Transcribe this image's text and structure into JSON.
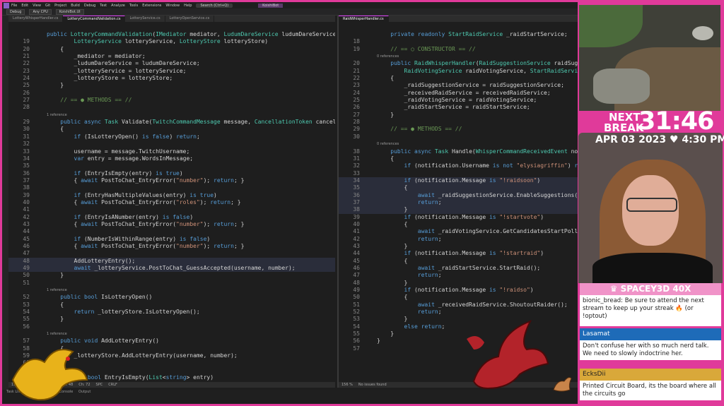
{
  "menubar": {
    "items": [
      "File",
      "Edit",
      "View",
      "Git",
      "Project",
      "Build",
      "Debug",
      "Test",
      "Analyze",
      "Tools",
      "Extensions",
      "Window",
      "Help"
    ],
    "search": "Search (Ctrl+Q)",
    "app_name": "KoishiBot"
  },
  "toolbar": {
    "config": "Debug",
    "platform": "Any CPU",
    "run_target": "KoishiBot.UI"
  },
  "left_editor": {
    "tabs": [
      "LotteryWhisperHandler.cs",
      "LotteryCommandValidation.cs",
      "LotteryService.cs",
      "LotteryOpenService.cs"
    ],
    "lines": [
      {
        "num": "",
        "text": "public LotteryCommandValidation(IMediator mediator, LudumDareService ludumDareService,",
        "hl": false
      },
      {
        "num": "19",
        "text": "        LotteryService lotteryService, LotteryStore lotteryStore)",
        "hl": false
      },
      {
        "num": "20",
        "text": "    {",
        "hl": false
      },
      {
        "num": "21",
        "text": "        _mediator = mediator;",
        "hl": false
      },
      {
        "num": "22",
        "text": "        _ludumDareService = ludumDareService;",
        "hl": false
      },
      {
        "num": "23",
        "text": "        _lotteryService = lotteryService;",
        "hl": false
      },
      {
        "num": "24",
        "text": "        _lotteryStore = lotteryStore;",
        "hl": false
      },
      {
        "num": "25",
        "text": "    }",
        "hl": false
      },
      {
        "num": "26",
        "text": "",
        "hl": false
      },
      {
        "num": "27",
        "text": "    // == ● METHODS == //",
        "hl": false
      },
      {
        "num": "28",
        "text": "",
        "hl": false
      },
      {
        "num": "ref",
        "text": "1 reference",
        "hl": false
      },
      {
        "num": "29",
        "text": "    public async Task Validate(TwitchCommandMessage message, CancellationToken cancelToken)",
        "hl": false
      },
      {
        "num": "30",
        "text": "    {",
        "hl": false
      },
      {
        "num": "31",
        "text": "        if (IsLotteryOpen() is false) return;",
        "hl": false
      },
      {
        "num": "32",
        "text": "",
        "hl": false
      },
      {
        "num": "33",
        "text": "        username = message.TwitchUsername;",
        "hl": false
      },
      {
        "num": "34",
        "text": "        var entry = message.WordsInMessage;",
        "hl": false
      },
      {
        "num": "35",
        "text": "",
        "hl": false
      },
      {
        "num": "36",
        "text": "        if (EntryIsEmpty(entry) is true)",
        "hl": false
      },
      {
        "num": "37",
        "text": "        { await PostToChat_EntryError(\"number\"); return; }",
        "hl": false
      },
      {
        "num": "38",
        "text": "",
        "hl": false
      },
      {
        "num": "39",
        "text": "        if (EntryHasMultipleValues(entry) is true)",
        "hl": false
      },
      {
        "num": "40",
        "text": "        { await PostToChat_EntryError(\"roles\"); return; }",
        "hl": false
      },
      {
        "num": "41",
        "text": "",
        "hl": false
      },
      {
        "num": "42",
        "text": "        if (EntryIsANumber(entry) is false)",
        "hl": false
      },
      {
        "num": "43",
        "text": "        { await PostToChat_EntryError(\"number\"); return; }",
        "hl": false
      },
      {
        "num": "44",
        "text": "",
        "hl": false
      },
      {
        "num": "45",
        "text": "        if (NumberIsWithinRange(entry) is false)",
        "hl": false
      },
      {
        "num": "46",
        "text": "        { await PostToChat_EntryError(\"number\"); return; }",
        "hl": false
      },
      {
        "num": "47",
        "text": "",
        "hl": false
      },
      {
        "num": "48",
        "text": "        AddLotteryEntry();",
        "hl": true
      },
      {
        "num": "49",
        "text": "        await _lotteryService.PostToChat_GuessAccepted(username, number);",
        "hl": true
      },
      {
        "num": "50",
        "text": "    }",
        "hl": false
      },
      {
        "num": "51",
        "text": "",
        "hl": false
      },
      {
        "num": "ref",
        "text": "1 reference",
        "hl": false
      },
      {
        "num": "52",
        "text": "    public bool IsLotteryOpen()",
        "hl": false
      },
      {
        "num": "53",
        "text": "    {",
        "hl": false
      },
      {
        "num": "54",
        "text": "        return _lotteryStore.IsLotteryOpen();",
        "hl": false
      },
      {
        "num": "55",
        "text": "    }",
        "hl": false
      },
      {
        "num": "56",
        "text": "",
        "hl": false
      },
      {
        "num": "ref",
        "text": "1 reference",
        "hl": false
      },
      {
        "num": "57",
        "text": "    public void AddLotteryEntry()",
        "hl": false
      },
      {
        "num": "58",
        "text": "    {",
        "hl": false
      },
      {
        "num": "59",
        "text": "        _lotteryStore.AddLotteryEntry(username, number);",
        "hl": false
      },
      {
        "num": "60",
        "text": "    }",
        "hl": false
      },
      {
        "num": "61",
        "text": "",
        "hl": false
      },
      {
        "num": "62",
        "text": "    private bool EntryIsEmpty(List<string> entry)",
        "hl": false
      }
    ],
    "status": [
      "156 %",
      "No issues found",
      "Ln: 48",
      "Ch: 72",
      "SPC",
      "CRLF"
    ]
  },
  "right_editor": {
    "tabs": [
      "RaidWhisperHandler.cs"
    ],
    "lines": [
      {
        "num": "",
        "text": "    private readonly StartRaidService _raidStartService;",
        "hl": false
      },
      {
        "num": "18",
        "text": "",
        "hl": false
      },
      {
        "num": "19",
        "text": "    // == ○ CONSTRUCTOR == //",
        "hl": false
      },
      {
        "num": "ref",
        "text": "0 references",
        "hl": false
      },
      {
        "num": "20",
        "text": "    public RaidWhisperHandler(RaidSuggestionService raidSuggestionServi",
        "hl": false
      },
      {
        "num": "21",
        "text": "        RaidVotingService raidVotingService, StartRaidService raidStart",
        "hl": false
      },
      {
        "num": "22",
        "text": "    {",
        "hl": false
      },
      {
        "num": "23",
        "text": "        _raidSuggestionService = raidSuggestionService;",
        "hl": false
      },
      {
        "num": "24",
        "text": "        _receivedRaidService = receivedRaidService;",
        "hl": false
      },
      {
        "num": "25",
        "text": "        _raidVotingService = raidVotingService;",
        "hl": false
      },
      {
        "num": "26",
        "text": "        _raidStartService = raidStartService;",
        "hl": false
      },
      {
        "num": "27",
        "text": "    }",
        "hl": false
      },
      {
        "num": "28",
        "text": "",
        "hl": false
      },
      {
        "num": "29",
        "text": "    // == ● METHODS == //",
        "hl": false
      },
      {
        "num": "30",
        "text": "",
        "hl": false
      },
      {
        "num": "ref",
        "text": "0 references",
        "hl": false
      },
      {
        "num": "38",
        "text": "    public async Task Handle(WhisperCommandReceivedEvent notification, C",
        "hl": false
      },
      {
        "num": "31",
        "text": "    {",
        "hl": false
      },
      {
        "num": "32",
        "text": "        if (notification.Username is not \"elysiagriffin\") return;",
        "hl": false
      },
      {
        "num": "33",
        "text": "",
        "hl": false
      },
      {
        "num": "34",
        "text": "        if (notification.Message is \"!raidsoon\")",
        "hl": true
      },
      {
        "num": "35",
        "text": "        {",
        "hl": true
      },
      {
        "num": "36",
        "text": "            await _raidSuggestionService.EnableSuggestions(cancellation",
        "hl": true
      },
      {
        "num": "37",
        "text": "            return;",
        "hl": true
      },
      {
        "num": "38",
        "text": "        }",
        "hl": true
      },
      {
        "num": "39",
        "text": "        if (notification.Message is \"!startvote\")",
        "hl": false
      },
      {
        "num": "40",
        "text": "        {",
        "hl": false
      },
      {
        "num": "41",
        "text": "            await _raidVotingService.GetCandidatesStartPoll(cancellatio",
        "hl": false
      },
      {
        "num": "42",
        "text": "            return;",
        "hl": false
      },
      {
        "num": "43",
        "text": "        }",
        "hl": false
      },
      {
        "num": "44",
        "text": "        if (notification.Message is \"!startraid\")",
        "hl": false
      },
      {
        "num": "45",
        "text": "        {",
        "hl": false
      },
      {
        "num": "46",
        "text": "            await _raidStartService.StartRaid();",
        "hl": false
      },
      {
        "num": "47",
        "text": "            return;",
        "hl": false
      },
      {
        "num": "48",
        "text": "        }",
        "hl": false
      },
      {
        "num": "49",
        "text": "        if (notification.Message is \"!raidso\")",
        "hl": false
      },
      {
        "num": "50",
        "text": "        {",
        "hl": false
      },
      {
        "num": "51",
        "text": "            await _receivedRaidService.ShoutoutRaider();",
        "hl": false
      },
      {
        "num": "52",
        "text": "            return;",
        "hl": false
      },
      {
        "num": "53",
        "text": "        }",
        "hl": false
      },
      {
        "num": "54",
        "text": "        else return;",
        "hl": false
      },
      {
        "num": "55",
        "text": "    }",
        "hl": false
      },
      {
        "num": "56",
        "text": "}",
        "hl": false
      },
      {
        "num": "57",
        "text": "",
        "hl": false
      }
    ],
    "status": [
      "156 %",
      "No issues found"
    ]
  },
  "bottom_tabs": [
    "Task List",
    "Package Manager Console",
    "Output"
  ],
  "overlay": {
    "timer_next": "NEXT",
    "timer_break": "BREAK",
    "timer_value": "31:46",
    "date": "APR 03 2023",
    "heart": "♥",
    "time": "4:30 PM",
    "sub_banner": "SPACEY3D 40X",
    "chat": [
      {
        "user": "",
        "text": "bionic_bread: Be sure to attend the next stream to keep up your streak 🔥 (or !optout)"
      },
      {
        "user": "Lasamat",
        "text": "Don't confuse her with so much nerd talk. We need to slowly indoctrine her."
      },
      {
        "user": "EcksDii",
        "text": "Printed Circuit Board, its the board where all the circuits go"
      }
    ]
  },
  "colors": {
    "accent": "#e03a9a",
    "keyword": "#569cd6",
    "type": "#4ec9b0",
    "method": "#dcdcaa",
    "string": "#ce9178"
  }
}
